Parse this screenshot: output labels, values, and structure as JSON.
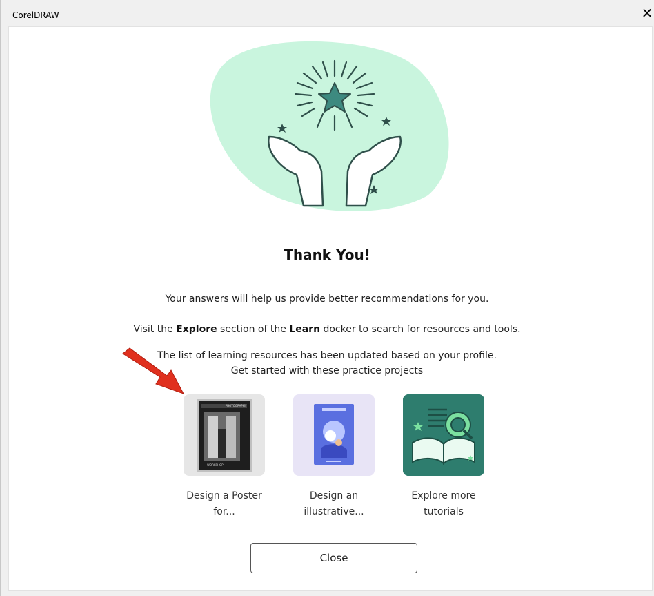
{
  "window": {
    "title": "CorelDRAW",
    "close_glyph": "✕"
  },
  "dialog": {
    "heading": "Thank You!",
    "line1": "Your answers will help us provide better recommendations for you.",
    "line2_pre": "Visit the ",
    "line2_explore": "Explore",
    "line2_mid": " section of the ",
    "line2_learn": "Learn",
    "line2_post": " docker to search for resources and tools.",
    "line3": "The list of learning resources has been updated based on your profile.",
    "line4": "Get started with these practice projects",
    "cards": [
      {
        "label_1": "Design a Poster",
        "label_2": "for...",
        "icon": "poster-thumbnail",
        "bg": "#e6e6e6",
        "poster_top": "PHOTOGRAPHY",
        "poster_bottom": "WORKSHOP"
      },
      {
        "label_1": "Design an",
        "label_2": "illustrative...",
        "icon": "illustration-thumbnail",
        "bg": "#e8e4f6"
      },
      {
        "label_1": "Explore more",
        "label_2": "tutorials",
        "icon": "open-book-icon",
        "bg": "#2e7d6e"
      }
    ],
    "close_label": "Close"
  },
  "colors": {
    "blob": "#c9f5de",
    "accent_teal": "#3d8a80",
    "arrow_red": "#e0301e"
  }
}
